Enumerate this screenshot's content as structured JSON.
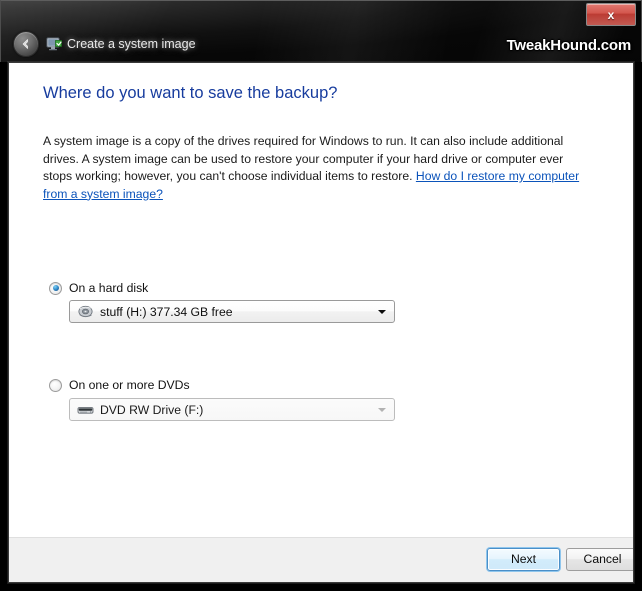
{
  "window": {
    "title": "Create a system image",
    "app_icon": "system-image-monitor-icon",
    "close_label": "x",
    "back_label": "Back",
    "watermark": "TweakHound.com"
  },
  "page": {
    "heading": "Where do you want to save the backup?",
    "description_part1": "A system image is a copy of the drives required for Windows to run. It can also include additional drives. A system image can be used to restore your computer if your hard drive or computer ever stops working; however, you can't choose individual items to restore. ",
    "help_link": "How do I restore my computer from a system image?"
  },
  "options": {
    "hard_disk": {
      "label": "On a hard disk",
      "selected": true,
      "combo": {
        "icon": "hard-disk-icon",
        "value": "stuff (H:)  377.34 GB free",
        "enabled": true
      }
    },
    "dvd": {
      "label": "On one or more DVDs",
      "selected": false,
      "combo": {
        "icon": "dvd-drive-icon",
        "value": "DVD RW Drive (F:)",
        "enabled": false
      }
    }
  },
  "footer": {
    "next_label": "Next",
    "cancel_label": "Cancel"
  },
  "colors": {
    "heading": "#173c9e",
    "link": "#0b53ba",
    "titlebar": "#070707",
    "footer": "#f0f0f0",
    "close_button": "#c2554c",
    "radio_dot": "#2a82c4"
  }
}
